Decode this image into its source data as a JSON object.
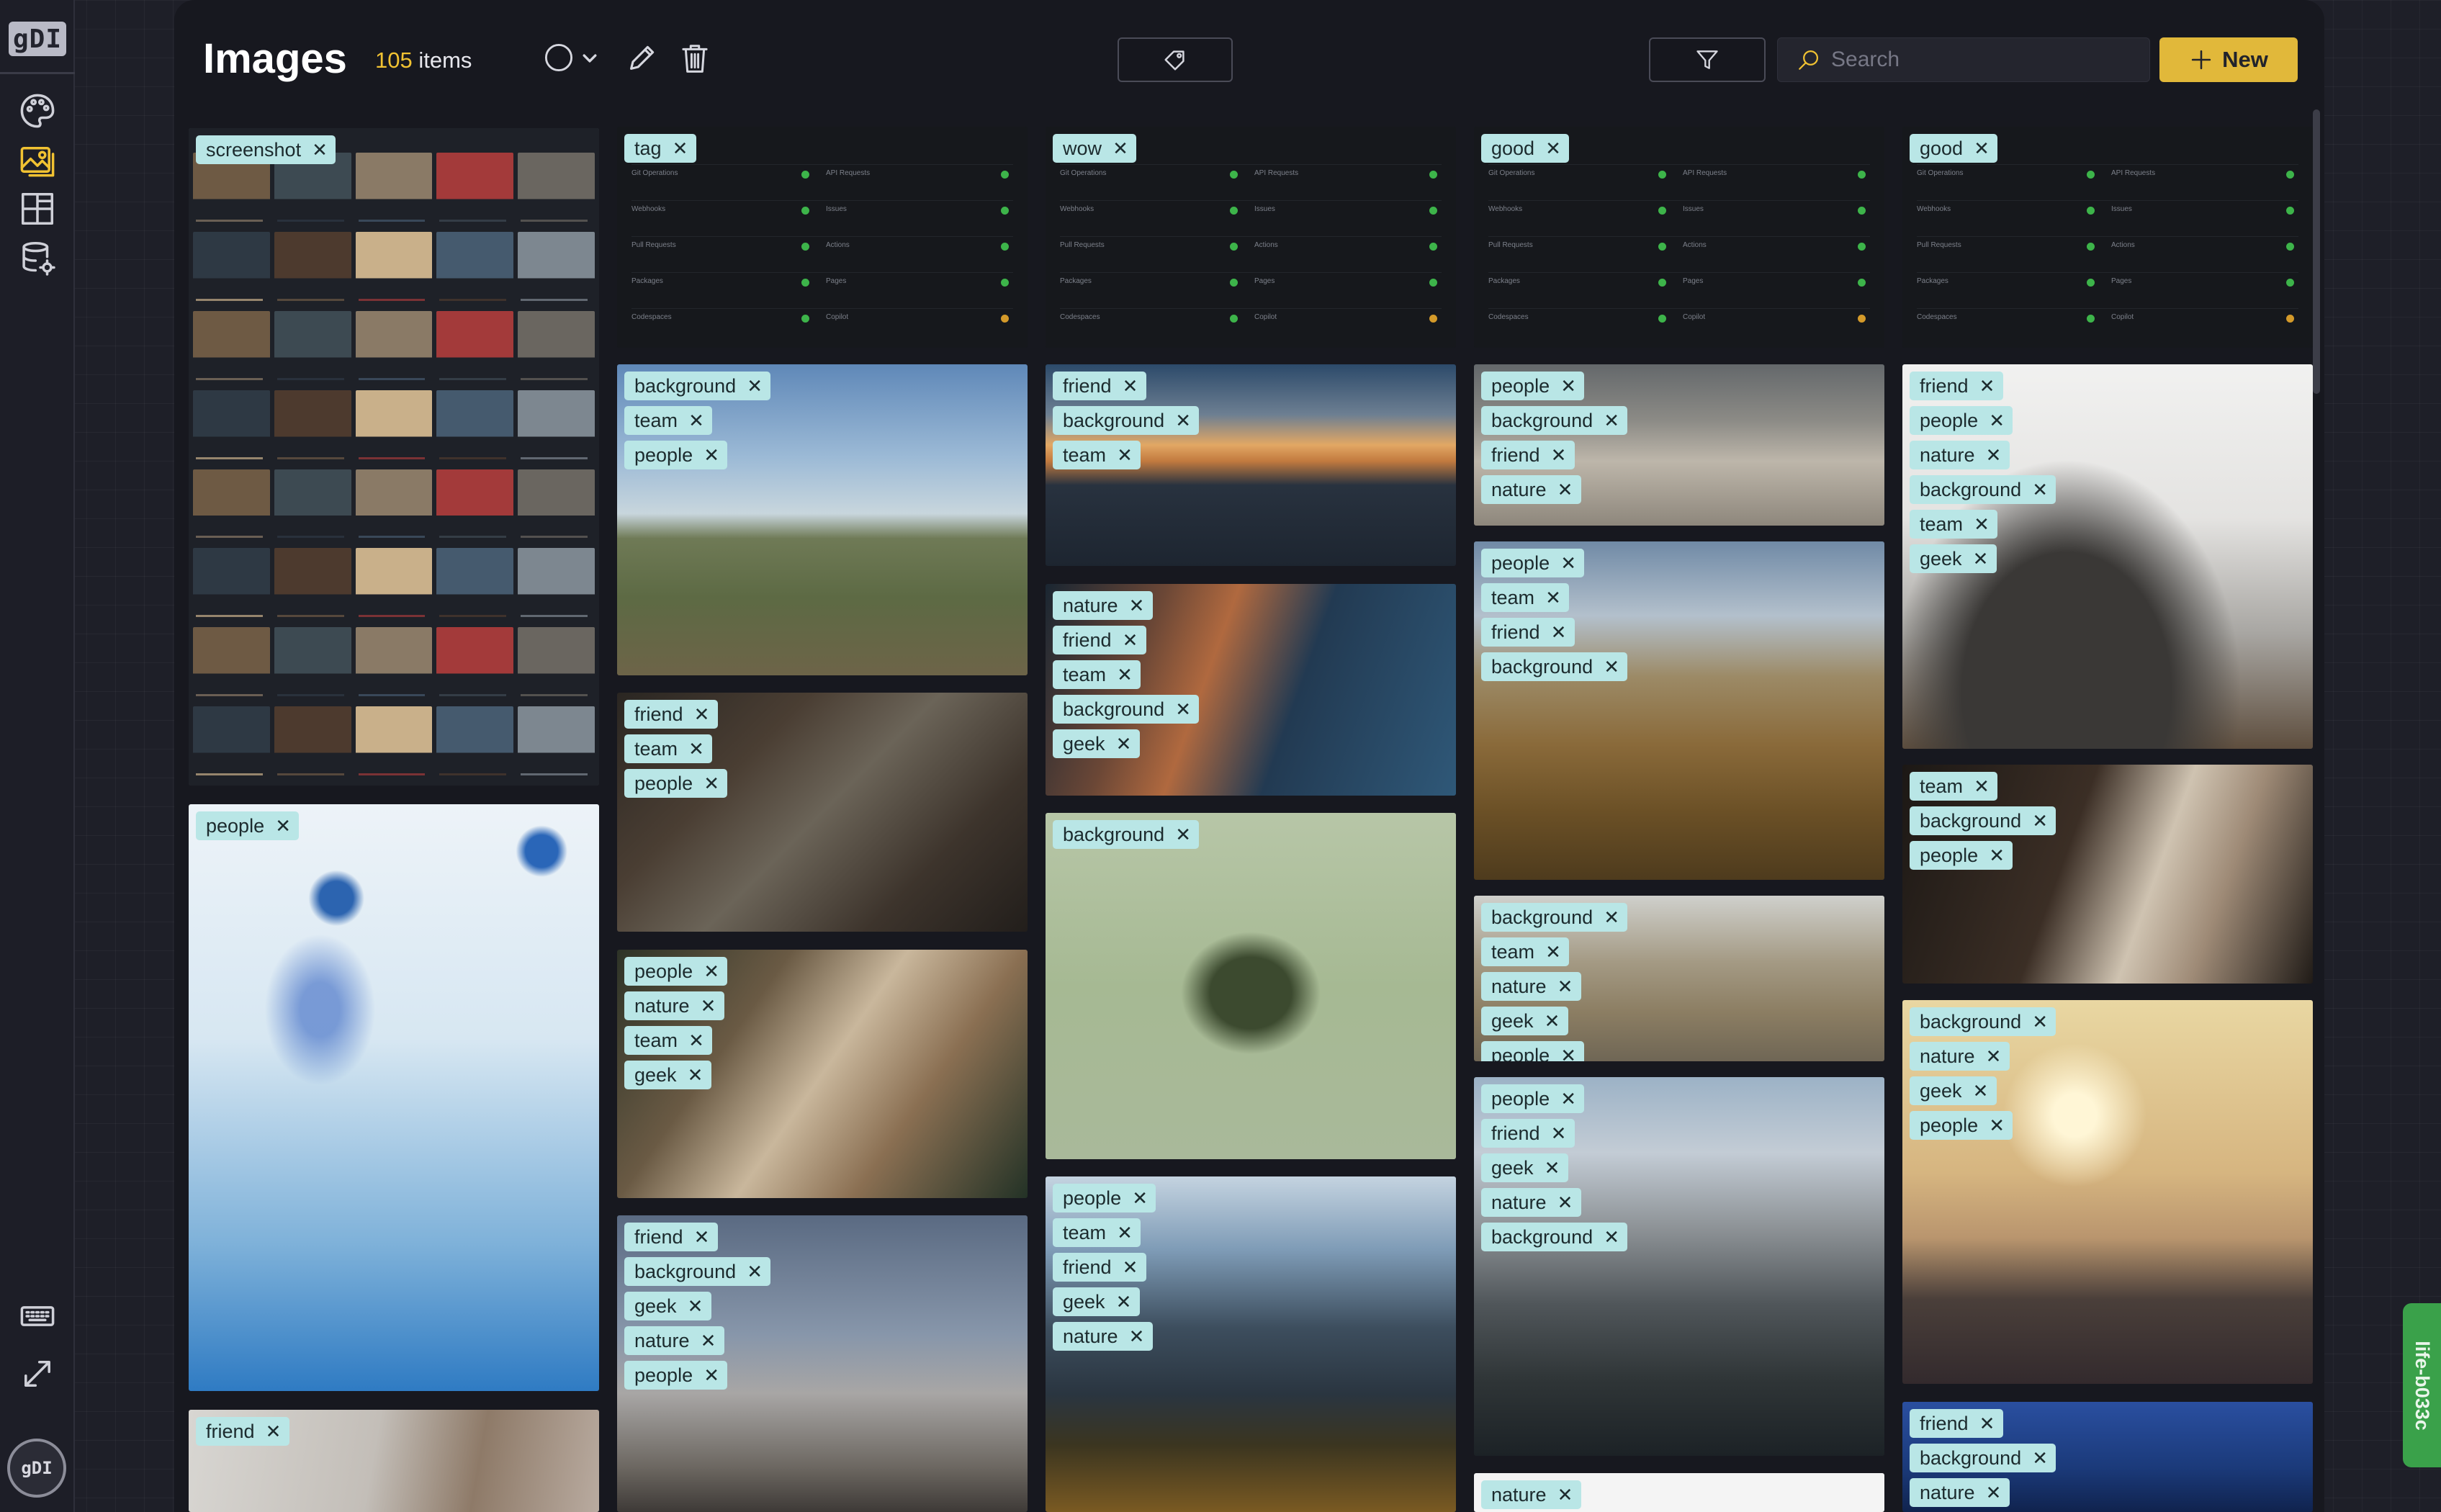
{
  "sidebar": {
    "logo_text": "gDI",
    "items": [
      {
        "name": "palette-icon"
      },
      {
        "name": "images-icon",
        "active": true
      },
      {
        "name": "layout-icon"
      },
      {
        "name": "database-settings-icon"
      }
    ],
    "bottom": [
      {
        "name": "keyboard-icon"
      },
      {
        "name": "expand-icon"
      }
    ],
    "avatar_text": "gDI"
  },
  "header": {
    "title": "Images",
    "count": "105",
    "count_suffix": "items",
    "search_placeholder": "Search",
    "new_label": "New"
  },
  "badge_text": "life-b033c",
  "status_rows": [
    [
      "Git Operations",
      "API Requests"
    ],
    [
      "Webhooks",
      "Issues"
    ],
    [
      "Pull Requests",
      "Actions"
    ],
    [
      "Packages",
      "Pages"
    ],
    [
      "Codespaces",
      "Copilot"
    ]
  ],
  "columns": [
    [
      {
        "tags": [
          "screenshot"
        ],
        "bg": "screens"
      },
      {
        "tags": [
          "people"
        ],
        "bg": "jelly"
      },
      {
        "tags": [
          "friend"
        ],
        "bg": "fog"
      }
    ],
    [
      {
        "tags": [
          "tag"
        ],
        "bg": "status"
      },
      {
        "tags": [
          "background",
          "team",
          "people"
        ],
        "bg": "sky"
      },
      {
        "tags": [
          "friend",
          "team",
          "people"
        ],
        "bg": "tools"
      },
      {
        "tags": [
          "people",
          "nature",
          "team",
          "geek"
        ],
        "bg": "cabin"
      },
      {
        "tags": [
          "friend",
          "background",
          "geek",
          "nature",
          "people"
        ],
        "bg": "haze"
      }
    ],
    [
      {
        "tags": [
          "wow"
        ],
        "bg": "status"
      },
      {
        "tags": [
          "friend",
          "background",
          "team"
        ],
        "bg": "sunset"
      },
      {
        "tags": [
          "nature",
          "friend",
          "team",
          "background",
          "geek"
        ],
        "bg": "cliff"
      },
      {
        "tags": [
          "background"
        ],
        "bg": "frog"
      },
      {
        "tags": [
          "people",
          "team",
          "friend",
          "geek",
          "nature"
        ],
        "bg": "alps"
      }
    ],
    [
      {
        "tags": [
          "good"
        ],
        "bg": "status"
      },
      {
        "tags": [
          "people",
          "background",
          "friend",
          "nature"
        ],
        "bg": "steps"
      },
      {
        "tags": [
          "people",
          "team",
          "friend",
          "background"
        ],
        "bg": "ridge"
      },
      {
        "tags": [
          "background",
          "team",
          "nature",
          "geek",
          "people"
        ],
        "bg": "highway"
      },
      {
        "tags": [
          "people",
          "friend",
          "geek",
          "nature",
          "background"
        ],
        "bg": "peak"
      },
      {
        "tags": [
          "nature"
        ],
        "bg": "white"
      }
    ],
    [
      {
        "tags": [
          "good"
        ],
        "bg": "status"
      },
      {
        "tags": [
          "friend",
          "people",
          "nature",
          "background",
          "team",
          "geek"
        ],
        "bg": "vinyl"
      },
      {
        "tags": [
          "team",
          "background",
          "people"
        ],
        "bg": "falls"
      },
      {
        "tags": [
          "background",
          "nature",
          "geek",
          "people"
        ],
        "bg": "meadow"
      },
      {
        "tags": [
          "friend",
          "background",
          "nature"
        ],
        "bg": "night"
      }
    ]
  ]
}
